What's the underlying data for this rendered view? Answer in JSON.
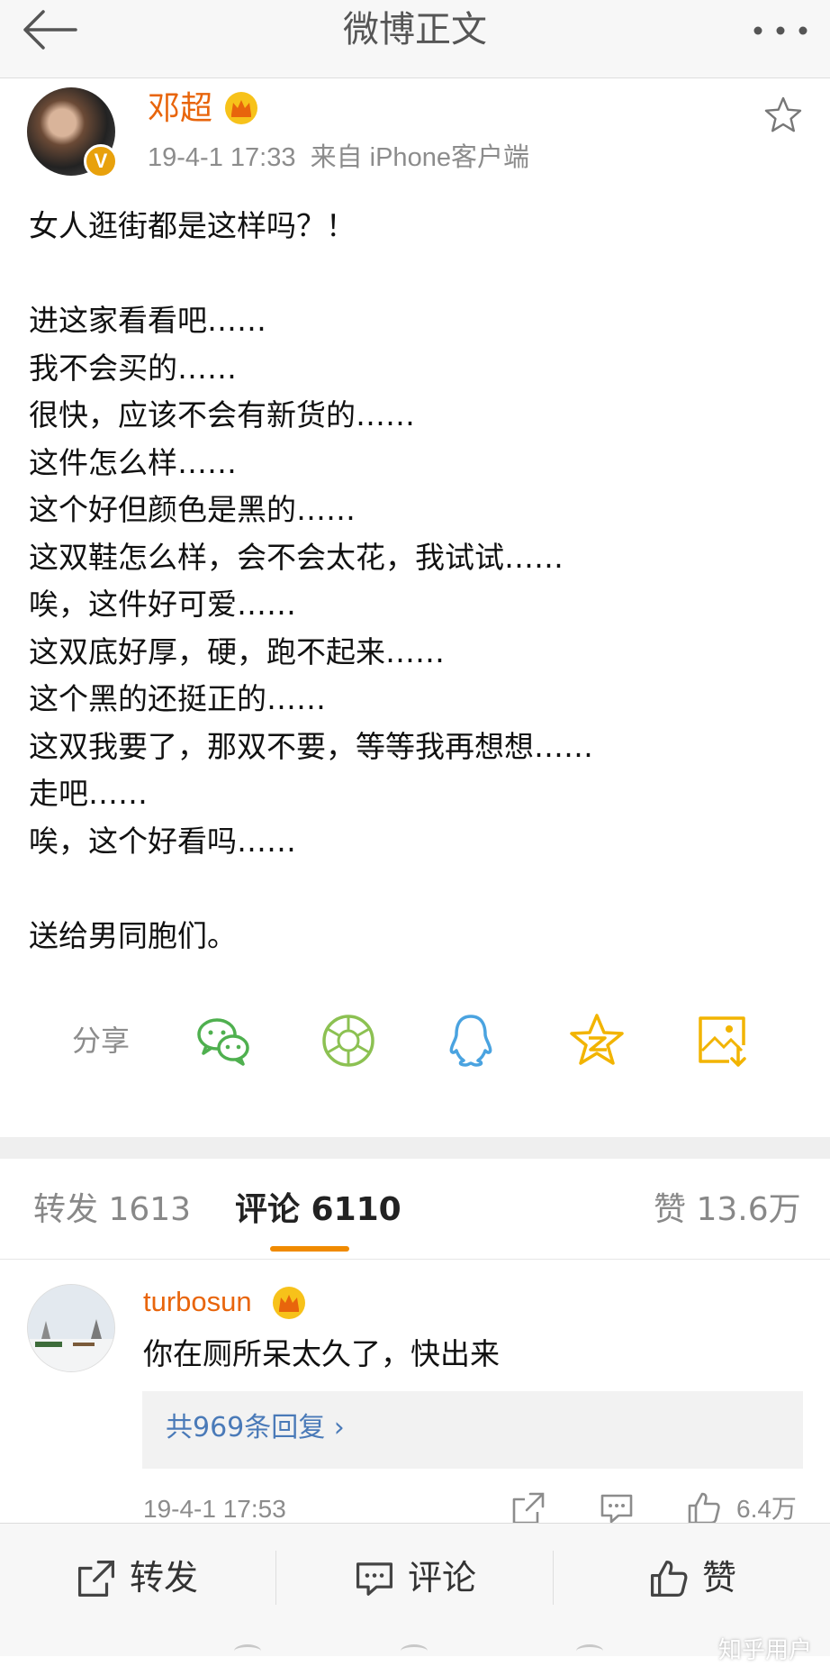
{
  "header": {
    "title": "微博正文"
  },
  "post": {
    "author": "邓超",
    "verified_badge": "V",
    "time": "19-4-1 17:33",
    "source": "来自 iPhone客户端",
    "lines": [
      "女人逛街都是这样吗？！",
      "",
      "进这家看看吧……",
      "我不会买的……",
      "很快，应该不会有新货的……",
      "这件怎么样……",
      "这个好但颜色是黑的……",
      "这双鞋怎么样，会不会太花，我试试……",
      "唉，这件好可爱……",
      "这双底好厚，硬，跑不起来……",
      "这个黑的还挺正的……",
      "这双我要了，那双不要，等等我再想想……",
      "走吧……",
      "唉，这个好看吗……",
      "",
      "送给男同胞们。"
    ]
  },
  "share": {
    "label": "分享",
    "icons": [
      "wechat-icon",
      "moments-icon",
      "qq-icon",
      "qzone-icon",
      "save-image-icon"
    ]
  },
  "tabs": {
    "repost": "转发 1613",
    "comment": "评论 6110",
    "like": "赞 13.6万"
  },
  "comment": {
    "user": "turbosun",
    "text": "你在厕所呆太久了，快出来",
    "replies_link": "共969条回复 ›",
    "time": "19-4-1 17:53",
    "like_count": "6.4万"
  },
  "bottom_bar": {
    "repost": "转发",
    "comment": "评论",
    "like": "赞"
  },
  "watermark": "知乎用户",
  "colors": {
    "accent": "#f08a00",
    "name": "#e8650c",
    "link": "#4a7ab8",
    "wechat": "#4fb04f",
    "moments": "#8cc152",
    "qq": "#4aa3e0",
    "qzone": "#f2b400",
    "save": "#f2b400"
  }
}
